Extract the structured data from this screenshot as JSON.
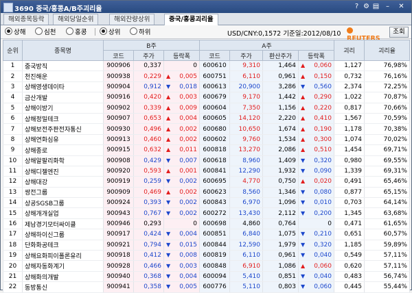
{
  "window": {
    "title": "3690 중국/홍콩A/B주괴리율"
  },
  "titlebar_buttons": [
    "?",
    "⚙",
    "▤",
    "–",
    "✕"
  ],
  "tabs": [
    {
      "label": "해외종목등락",
      "active": false
    },
    {
      "label": "해외당일순위",
      "active": false
    },
    {
      "label": "해외잔량상위",
      "active": false
    },
    {
      "label": "중국/홍콩괴리율",
      "active": true
    }
  ],
  "market_options": [
    {
      "label": "상해",
      "selected": true
    },
    {
      "label": "심천",
      "selected": false
    },
    {
      "label": "홍콩",
      "selected": false
    }
  ],
  "rank_options": [
    {
      "label": "상위",
      "selected": true
    },
    {
      "label": "하위",
      "selected": false
    }
  ],
  "fx_text": "USD/CNY:0,1572  기준일:2012/08/10",
  "reuters_label": "REUTERS",
  "search_button": "조회",
  "headers": {
    "rank": "순위",
    "name": "종목명",
    "bshare": "B주",
    "ashare": "A주",
    "code": "코드",
    "price": "주가",
    "change": "등락폭",
    "converted": "환산주가",
    "gap": "괴리",
    "gap_rate": "괴리율"
  },
  "colors": {
    "up": "#e21d1d",
    "down": "#1c47cc",
    "b_bg": "#fdeff3",
    "a_bg": "#eef4fb"
  },
  "rows": [
    {
      "rank": "1",
      "name": "중국방직",
      "b_code": "900906",
      "b_price": "0,337",
      "b_dir": "flat",
      "b_chg": "0",
      "a_code": "600610",
      "a_price": "9,310",
      "a_conv": "1,464",
      "a_dir": "up",
      "a_chg": "0,060",
      "gap": "1,127",
      "rate": "76,98%"
    },
    {
      "rank": "2",
      "name": "천진해운",
      "b_code": "900938",
      "b_price": "0,229",
      "b_dir": "up",
      "b_chg": "0,005",
      "a_code": "600751",
      "a_price": "6,110",
      "a_conv": "0,961",
      "a_dir": "up",
      "a_chg": "0,150",
      "gap": "0,732",
      "rate": "76,16%"
    },
    {
      "rank": "3",
      "name": "상해영생데이타",
      "b_code": "900904",
      "b_price": "0,912",
      "b_dir": "down",
      "b_chg": "0,018",
      "a_code": "600613",
      "a_price": "20,900",
      "a_conv": "3,286",
      "a_dir": "down",
      "a_chg": "0,560",
      "gap": "2,374",
      "rate": "72,25%"
    },
    {
      "rank": "4",
      "name": "금산개발",
      "b_code": "900916",
      "b_price": "0,420",
      "b_dir": "up",
      "b_chg": "0,003",
      "a_code": "600679",
      "a_price": "9,170",
      "a_conv": "1,442",
      "a_dir": "up",
      "a_chg": "0,290",
      "gap": "1,022",
      "rate": "70,87%"
    },
    {
      "rank": "5",
      "name": "상해이방기",
      "b_code": "900902",
      "b_price": "0,339",
      "b_dir": "up",
      "b_chg": "0,009",
      "a_code": "600604",
      "a_price": "7,350",
      "a_conv": "1,156",
      "a_dir": "up",
      "a_chg": "0,220",
      "gap": "0,817",
      "rate": "70,66%"
    },
    {
      "rank": "6",
      "name": "상해정밀테크",
      "b_code": "900907",
      "b_price": "0,653",
      "b_dir": "up",
      "b_chg": "0,004",
      "a_code": "600605",
      "a_price": "14,120",
      "a_conv": "2,220",
      "a_dir": "up",
      "a_chg": "0,410",
      "gap": "1,567",
      "rate": "70,59%"
    },
    {
      "rank": "7",
      "name": "상해보전주판전자통신",
      "b_code": "900930",
      "b_price": "0,496",
      "b_dir": "up",
      "b_chg": "0,002",
      "a_code": "600680",
      "a_price": "10,650",
      "a_conv": "1,674",
      "a_dir": "up",
      "a_chg": "0,190",
      "gap": "1,178",
      "rate": "70,38%"
    },
    {
      "rank": "8",
      "name": "상해연화심유",
      "b_code": "900913",
      "b_price": "0,460",
      "b_dir": "up",
      "b_chg": "0,002",
      "a_code": "600602",
      "a_price": "9,760",
      "a_conv": "1,534",
      "a_dir": "up",
      "a_chg": "0,300",
      "gap": "1,074",
      "rate": "70,02%"
    },
    {
      "rank": "9",
      "name": "상해종로",
      "b_code": "900915",
      "b_price": "0,632",
      "b_dir": "up",
      "b_chg": "0,011",
      "a_code": "600818",
      "a_price": "13,270",
      "a_conv": "2,086",
      "a_dir": "up",
      "a_chg": "0,510",
      "gap": "1,454",
      "rate": "69,71%"
    },
    {
      "rank": "10",
      "name": "상해알팔리화학",
      "b_code": "900908",
      "b_price": "0,429",
      "b_dir": "down",
      "b_chg": "0,007",
      "a_code": "600618",
      "a_price": "8,960",
      "a_conv": "1,409",
      "a_dir": "down",
      "a_chg": "0,320",
      "gap": "0,980",
      "rate": "69,55%"
    },
    {
      "rank": "11",
      "name": "상해디젤엔진",
      "b_code": "900920",
      "b_price": "0,593",
      "b_dir": "up",
      "b_chg": "0,001",
      "a_code": "600841",
      "a_price": "12,290",
      "a_conv": "1,932",
      "a_dir": "down",
      "a_chg": "0,090",
      "gap": "1,339",
      "rate": "69,31%"
    },
    {
      "rank": "12",
      "name": "상해대강",
      "b_code": "900919",
      "b_price": "0,259",
      "b_dir": "down",
      "b_chg": "0,002",
      "a_code": "600695",
      "a_price": "4,770",
      "a_conv": "0,750",
      "a_dir": "up",
      "a_chg": "0,020",
      "gap": "0,491",
      "rate": "65,46%"
    },
    {
      "rank": "13",
      "name": "쌍전그룹",
      "b_code": "900909",
      "b_price": "0,469",
      "b_dir": "up",
      "b_chg": "0,002",
      "a_code": "600623",
      "a_price": "8,560",
      "a_conv": "1,346",
      "a_dir": "down",
      "a_chg": "0,080",
      "gap": "0,877",
      "rate": "65,15%"
    },
    {
      "rank": "14",
      "name": "상공SGSB그룹",
      "b_code": "900924",
      "b_price": "0,393",
      "b_dir": "down",
      "b_chg": "0,002",
      "a_code": "600843",
      "a_price": "6,970",
      "a_conv": "1,096",
      "a_dir": "down",
      "a_chg": "0,010",
      "gap": "0,703",
      "rate": "64,14%"
    },
    {
      "rank": "15",
      "name": "상해개개실업",
      "b_code": "900943",
      "b_price": "0,767",
      "b_dir": "down",
      "b_chg": "0,002",
      "a_code": "600272",
      "a_price": "13,430",
      "a_conv": "2,112",
      "a_dir": "down",
      "a_chg": "0,200",
      "gap": "1,345",
      "rate": "63,68%"
    },
    {
      "rank": "16",
      "name": "제남경기모터싸이클",
      "b_code": "900946",
      "b_price": "0,293",
      "b_dir": "flat",
      "b_chg": "0",
      "a_code": "600698",
      "a_price": "4,860",
      "a_conv": "0,764",
      "a_dir": "flat",
      "a_chg": "0",
      "gap": "0,471",
      "rate": "61,65%"
    },
    {
      "rank": "17",
      "name": "상해하이신그룹",
      "b_code": "900917",
      "b_price": "0,424",
      "b_dir": "down",
      "b_chg": "0,004",
      "a_code": "600851",
      "a_price": "6,840",
      "a_conv": "1,075",
      "a_dir": "down",
      "a_chg": "0,210",
      "gap": "0,651",
      "rate": "60,57%"
    },
    {
      "rank": "18",
      "name": "단화화공테크",
      "b_code": "900921",
      "b_price": "0,794",
      "b_dir": "down",
      "b_chg": "0,015",
      "a_code": "600844",
      "a_price": "12,590",
      "a_conv": "1,979",
      "a_dir": "down",
      "a_chg": "0,320",
      "gap": "1,185",
      "rate": "59,89%"
    },
    {
      "rank": "19",
      "name": "상해요화피이폴론유리",
      "b_code": "900918",
      "b_price": "0,412",
      "b_dir": "down",
      "b_chg": "0,008",
      "a_code": "600819",
      "a_price": "6,110",
      "a_conv": "0,961",
      "a_dir": "down",
      "a_chg": "0,040",
      "gap": "0,549",
      "rate": "57,11%"
    },
    {
      "rank": "20",
      "name": "상해자동화계기",
      "b_code": "900928",
      "b_price": "0,466",
      "b_dir": "down",
      "b_chg": "0,003",
      "a_code": "600848",
      "a_price": "6,910",
      "a_conv": "1,086",
      "a_dir": "up",
      "a_chg": "0,060",
      "gap": "0,620",
      "rate": "57,11%"
    },
    {
      "rank": "21",
      "name": "상해화의개발",
      "b_code": "900940",
      "b_price": "0,368",
      "b_dir": "down",
      "b_chg": "0,004",
      "a_code": "600094",
      "a_price": "5,410",
      "a_conv": "0,851",
      "a_dir": "down",
      "a_chg": "0,040",
      "gap": "0,483",
      "rate": "56,74%"
    },
    {
      "rank": "22",
      "name": "동방통신",
      "b_code": "900941",
      "b_price": "0,358",
      "b_dir": "down",
      "b_chg": "0,005",
      "a_code": "600776",
      "a_price": "5,110",
      "a_conv": "0,803",
      "a_dir": "down",
      "a_chg": "0,060",
      "gap": "0,445",
      "rate": "55,44%"
    }
  ]
}
